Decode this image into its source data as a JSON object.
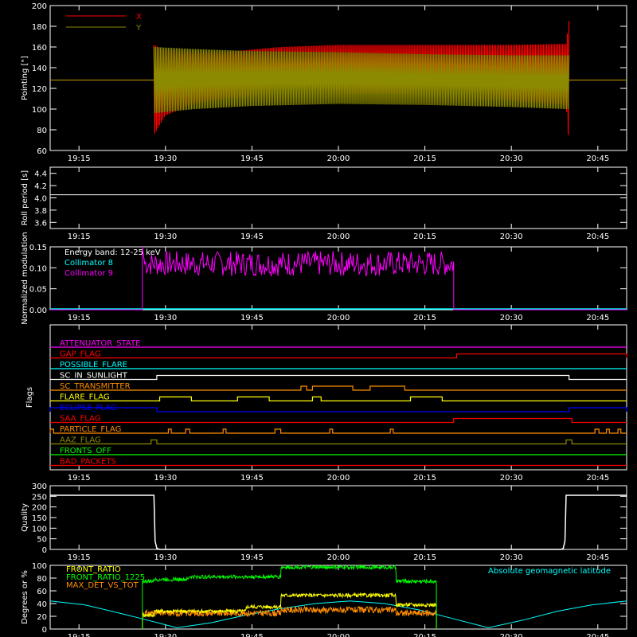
{
  "time_axis": {
    "start_min": 1150,
    "end_min": 1250,
    "ticks": [
      {
        "t": 1155,
        "label": "19:15"
      },
      {
        "t": 1170,
        "label": "19:30"
      },
      {
        "t": 1185,
        "label": "19:45"
      },
      {
        "t": 1200,
        "label": "20:00"
      },
      {
        "t": 1215,
        "label": "20:15"
      },
      {
        "t": 1230,
        "label": "20:30"
      },
      {
        "t": 1245,
        "label": "20:45"
      }
    ]
  },
  "chart_data": [
    {
      "id": "pointing",
      "type": "line",
      "ylabel": "Pointing [\"]",
      "ylim": [
        60,
        200
      ],
      "yticks": [
        60,
        80,
        100,
        120,
        140,
        160,
        180,
        200
      ],
      "legend": {
        "placement": "top-left",
        "entries": [
          {
            "name": "X",
            "color": "#ff0000"
          },
          {
            "name": "Y",
            "color": "#8c8a00"
          }
        ]
      },
      "baseline": 128,
      "data_start": 1168,
      "data_end": 1240,
      "series": [
        {
          "name": "X",
          "color": "#ff0000",
          "envelope": [
            {
              "t": 1168,
              "hi": 162,
              "lo": 75
            },
            {
              "t": 1170,
              "hi": 157,
              "lo": 94
            },
            {
              "t": 1175,
              "hi": 155,
              "lo": 105
            },
            {
              "t": 1180,
              "hi": 155,
              "lo": 110
            },
            {
              "t": 1190,
              "hi": 160,
              "lo": 113
            },
            {
              "t": 1200,
              "hi": 162,
              "lo": 115
            },
            {
              "t": 1210,
              "hi": 162,
              "lo": 115
            },
            {
              "t": 1220,
              "hi": 162,
              "lo": 112
            },
            {
              "t": 1230,
              "hi": 162,
              "lo": 108
            },
            {
              "t": 1239.5,
              "hi": 163,
              "lo": 104
            },
            {
              "t": 1240,
              "hi": 185,
              "lo": 64
            }
          ]
        },
        {
          "name": "Y",
          "color": "#8c8a00",
          "envelope": [
            {
              "t": 1168,
              "hi": 160,
              "lo": 96
            },
            {
              "t": 1175,
              "hi": 158,
              "lo": 100
            },
            {
              "t": 1185,
              "hi": 156,
              "lo": 103
            },
            {
              "t": 1200,
              "hi": 155,
              "lo": 105
            },
            {
              "t": 1215,
              "hi": 153,
              "lo": 104
            },
            {
              "t": 1230,
              "hi": 152,
              "lo": 102
            },
            {
              "t": 1239.5,
              "hi": 152,
              "lo": 100
            }
          ]
        }
      ]
    },
    {
      "id": "roll",
      "type": "line",
      "ylabel": "Roll period [s]",
      "ylim": [
        3.5,
        4.5
      ],
      "yticks": [
        3.6,
        3.8,
        4.0,
        4.2,
        4.4
      ],
      "series": [
        {
          "color": "#ffffff",
          "points": [
            [
              1150,
              4.05
            ],
            [
              1250,
              4.05
            ]
          ]
        }
      ]
    },
    {
      "id": "modulation",
      "type": "line",
      "ylabel": "Normalized modulation",
      "ylim": [
        0,
        0.15
      ],
      "yticks": [
        0.0,
        0.05,
        0.1,
        0.15
      ],
      "legend": {
        "placement": "top-left",
        "entries": [
          {
            "name": "Energy band:  12-25 keV",
            "color": "#ffffff"
          },
          {
            "name": "Collimator 8",
            "color": "#00ffff"
          },
          {
            "name": "Collimator 9",
            "color": "#ff00ff"
          }
        ]
      },
      "data_start": 1166,
      "data_end": 1220,
      "series": [
        {
          "name": "Collimator 8",
          "color": "#00ffff",
          "points": [
            [
              1150,
              0
            ],
            [
              1250,
              0
            ]
          ]
        },
        {
          "name": "Collimator 9",
          "color": "#ff00ff",
          "level": 0.11,
          "band": 0.03
        }
      ]
    },
    {
      "id": "flags",
      "type": "line",
      "ylabel": "Flags",
      "flags": [
        {
          "name": "ATTENUATOR_STATE",
          "color": "#ff00ff",
          "segments": []
        },
        {
          "name": "GAP_FLAG",
          "color": "#ff0000",
          "segments": [
            [
              1220.5,
              1250
            ]
          ]
        },
        {
          "name": "POSSIBLE_FLARE",
          "color": "#00ffff",
          "segments": []
        },
        {
          "name": "SC_IN_SUNLIGHT",
          "color": "#ffffff",
          "segments": [
            [
              1168.5,
              1240
            ]
          ]
        },
        {
          "name": "SC_TRANSMITTER",
          "color": "#ff8c00",
          "segments": [
            [
              1193.5,
              1194.5
            ],
            [
              1195.5,
              1202.5
            ],
            [
              1205.5,
              1211.5
            ]
          ]
        },
        {
          "name": "FLARE_FLAG",
          "color": "#ffff00",
          "segments": [
            [
              1169,
              1174.5
            ],
            [
              1182.5,
              1188
            ],
            [
              1195.5,
              1197
            ],
            [
              1212.5,
              1218
            ]
          ]
        },
        {
          "name": "ECLIPSE_FLAG",
          "color": "#0000ff",
          "segments": [
            [
              1150,
              1168.5
            ],
            [
              1240,
              1250
            ]
          ]
        },
        {
          "name": "SAA_FLAG",
          "color": "#ff0000",
          "segments": [
            [
              1220,
              1240.5
            ]
          ]
        },
        {
          "name": "PARTICLE_FLAG",
          "color": "#ff8c00",
          "segments": [
            [
              1150,
              1150.6
            ],
            [
              1170.5,
              1171
            ],
            [
              1173.5,
              1174.2
            ],
            [
              1180,
              1180.5
            ],
            [
              1189,
              1190
            ],
            [
              1198.5,
              1199
            ],
            [
              1209,
              1209.5
            ],
            [
              1244.5,
              1245.2
            ],
            [
              1246.5,
              1247
            ],
            [
              1248.5,
              1249
            ]
          ]
        },
        {
          "name": "AAZ_FLAG",
          "color": "#8c8a00",
          "segments": [
            [
              1167.5,
              1168.5
            ],
            [
              1239.5,
              1240.5
            ]
          ]
        },
        {
          "name": "FRONTS_OFF",
          "color": "#00ff00",
          "segments": []
        },
        {
          "name": "BAD_PACKETS",
          "color": "#ff0000",
          "segments": []
        }
      ]
    },
    {
      "id": "quality",
      "type": "line",
      "ylabel": "Quality",
      "ylim": [
        0,
        300
      ],
      "yticks": [
        0,
        50,
        100,
        150,
        200,
        250,
        300
      ],
      "series": [
        {
          "color": "#ffffff",
          "points": [
            [
              1150,
              255
            ],
            [
              1168,
              255
            ],
            [
              1168.2,
              40
            ],
            [
              1168.5,
              5
            ],
            [
              1169,
              0
            ],
            [
              1238.6,
              0
            ],
            [
              1239.0,
              5
            ],
            [
              1239.3,
              40
            ],
            [
              1239.5,
              255
            ],
            [
              1250,
              255
            ]
          ]
        }
      ]
    },
    {
      "id": "ratios",
      "type": "line",
      "ylabel": "Degrees or %",
      "ylim": [
        0,
        100
      ],
      "yticks": [
        0,
        20,
        40,
        60,
        80,
        100
      ],
      "legend": {
        "placement": "top-left",
        "entries": [
          {
            "name": "FRONT_RATIO",
            "color": "#ffff00"
          },
          {
            "name": "FRONT_RATIO_1225",
            "color": "#00ff00"
          },
          {
            "name": "MAX_DET_VS_TOT",
            "color": "#ff8c00"
          }
        ]
      },
      "annotation": {
        "text": "Absolute geomagnetic latitude",
        "color": "#00ffff",
        "placement": "top-right"
      },
      "data_start": 1166,
      "data_end": 1217,
      "series": [
        {
          "name": "FRONT_RATIO",
          "color": "#ffff00",
          "steps": [
            [
              1166,
              22
            ],
            [
              1168,
              28
            ],
            [
              1184,
              35
            ],
            [
              1190,
              53
            ],
            [
              1210,
              38
            ],
            [
              1217,
              38
            ]
          ],
          "noise": 3
        },
        {
          "name": "FRONT_RATIO_1225",
          "color": "#00ff00",
          "steps": [
            [
              1166,
              75
            ],
            [
              1168,
              78
            ],
            [
              1174,
              82
            ],
            [
              1190,
              97
            ],
            [
              1210,
              75
            ],
            [
              1217,
              72
            ]
          ],
          "noise": 3
        },
        {
          "name": "MAX_DET_VS_TOT",
          "color": "#ff8c00",
          "steps": [
            [
              1166,
              25
            ],
            [
              1190,
              30
            ],
            [
              1210,
              25
            ],
            [
              1217,
              22
            ]
          ],
          "noise": 5
        },
        {
          "name": "Absolute geomagnetic latitude",
          "color": "#00ffff",
          "points": [
            [
              1150,
              44
            ],
            [
              1156,
              38
            ],
            [
              1162,
              25
            ],
            [
              1166,
              16
            ],
            [
              1172,
              2
            ],
            [
              1178,
              10
            ],
            [
              1184,
              22
            ],
            [
              1190,
              32
            ],
            [
              1196,
              40
            ],
            [
              1202,
              44
            ],
            [
              1208,
              40
            ],
            [
              1214,
              30
            ],
            [
              1220,
              16
            ],
            [
              1226,
              2
            ],
            [
              1232,
              14
            ],
            [
              1238,
              28
            ],
            [
              1244,
              38
            ],
            [
              1250,
              44
            ]
          ]
        }
      ]
    }
  ]
}
